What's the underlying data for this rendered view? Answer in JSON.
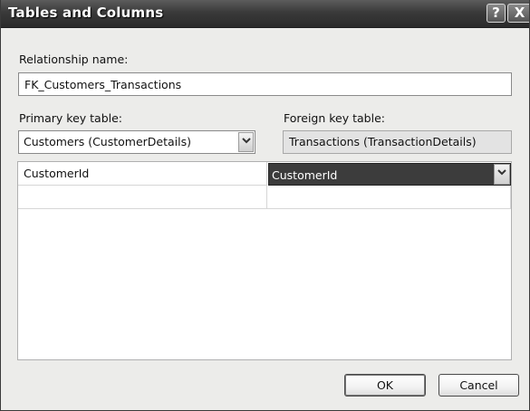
{
  "dialog": {
    "title": "Tables and Columns",
    "help_glyph": "?",
    "close_glyph": "X"
  },
  "relationship": {
    "label": "Relationship name:",
    "value": "FK_Customers_Transactions"
  },
  "primary_key": {
    "label": "Primary key table:",
    "selected": "Customers (CustomerDetails)"
  },
  "foreign_key": {
    "label": "Foreign key table:",
    "value": "Transactions (TransactionDetails)"
  },
  "columns_grid": {
    "rows": [
      {
        "primary": "CustomerId",
        "foreign": "CustomerId"
      },
      {
        "primary": "",
        "foreign": ""
      }
    ]
  },
  "buttons": {
    "ok": "OK",
    "cancel": "Cancel"
  },
  "icons": {
    "dropdown": "chevron-down-icon"
  }
}
